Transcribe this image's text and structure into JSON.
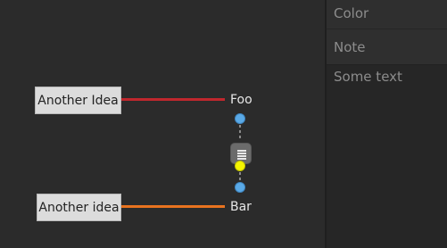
{
  "canvas": {
    "ideas": [
      {
        "label": "Another Idea",
        "target": "Foo",
        "line_color": "#c0272d"
      },
      {
        "label": "Another idea",
        "target": "Bar",
        "line_color": "#e8731f"
      }
    ],
    "connector": {
      "top_port_color": "#5aa9e6",
      "middle_port_color": "#f5f500",
      "bottom_port_color": "#5aa9e6",
      "menu_icon": "hamburger-icon"
    }
  },
  "sidebar": {
    "color_label": "Color",
    "note_label": "Note",
    "note_text": "Some text"
  }
}
